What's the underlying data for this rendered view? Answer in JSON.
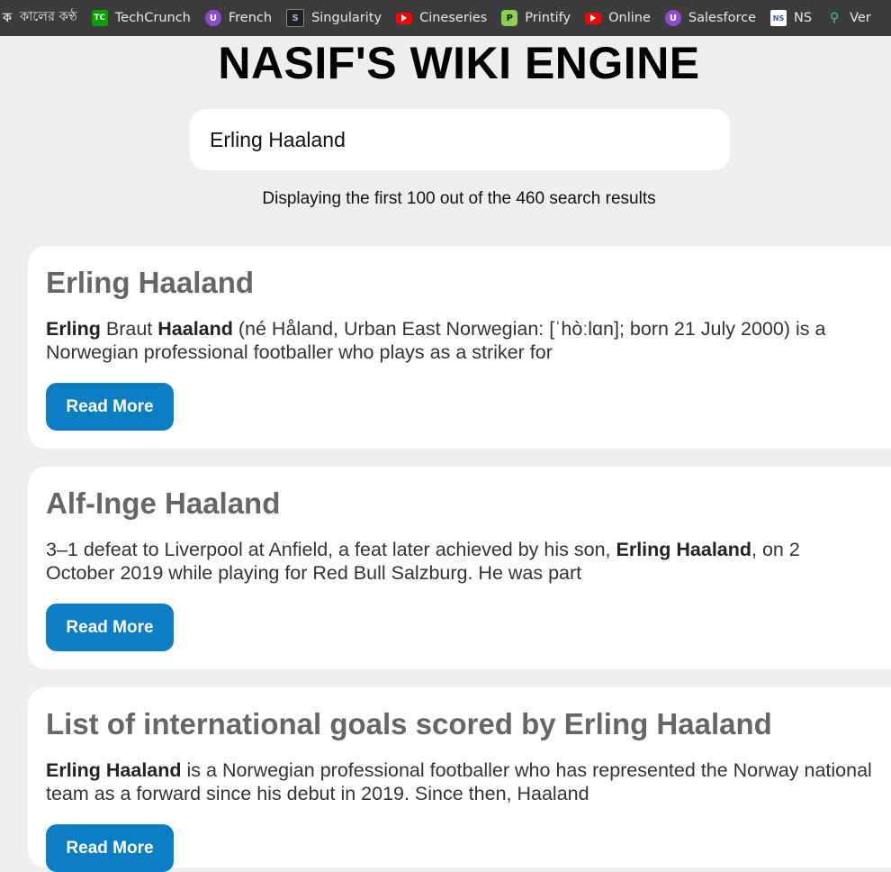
{
  "bookmarks": [
    {
      "label": "কালের কণ্ঠ",
      "icon": "kaler-kantho-icon",
      "glyph": "ক"
    },
    {
      "label": "TechCrunch",
      "icon": "techcrunch-icon",
      "glyph": "TC"
    },
    {
      "label": "French",
      "icon": "udemy-icon",
      "glyph": "U"
    },
    {
      "label": "Singularity",
      "icon": "singularity-icon",
      "glyph": "S"
    },
    {
      "label": "Cineseries",
      "icon": "youtube-icon",
      "glyph": ""
    },
    {
      "label": "Printify",
      "icon": "printify-icon",
      "glyph": "P"
    },
    {
      "label": "Online",
      "icon": "youtube-icon",
      "glyph": ""
    },
    {
      "label": "Salesforce",
      "icon": "udemy-icon",
      "glyph": "U"
    },
    {
      "label": "NS",
      "icon": "ns-icon",
      "glyph": "NS"
    },
    {
      "label": "Ver",
      "icon": "map-pin-icon",
      "glyph": "⚲"
    }
  ],
  "site": {
    "title": "NASIF'S WIKI ENGINE"
  },
  "search": {
    "value": "Erling Haaland"
  },
  "results_info": "Displaying the first 100 out of the 460 search results",
  "results": [
    {
      "title": "Erling Haaland",
      "snippet_html": "<b>Erling</b> Braut <b>Haaland</b> (né Håland, Urban East Norwegian: [ˈhòːlɑn]; born 21 July 2000) is a Norwegian professional footballer who plays as a striker for",
      "button": "Read More"
    },
    {
      "title": "Alf-Inge Haaland",
      "snippet_html": "3–1 defeat to Liverpool at Anfield, a feat later achieved by his son, <b>Erling Haaland</b>, on 2 October 2019 while playing for Red Bull Salzburg. He was part",
      "button": "Read More"
    },
    {
      "title": "List of international goals scored by Erling Haaland",
      "snippet_html": "<b>Erling Haaland</b> is a Norwegian professional footballer who has represented the Norway national team as a forward since his debut in 2019. Since then, Haaland",
      "button": "Read More"
    }
  ]
}
